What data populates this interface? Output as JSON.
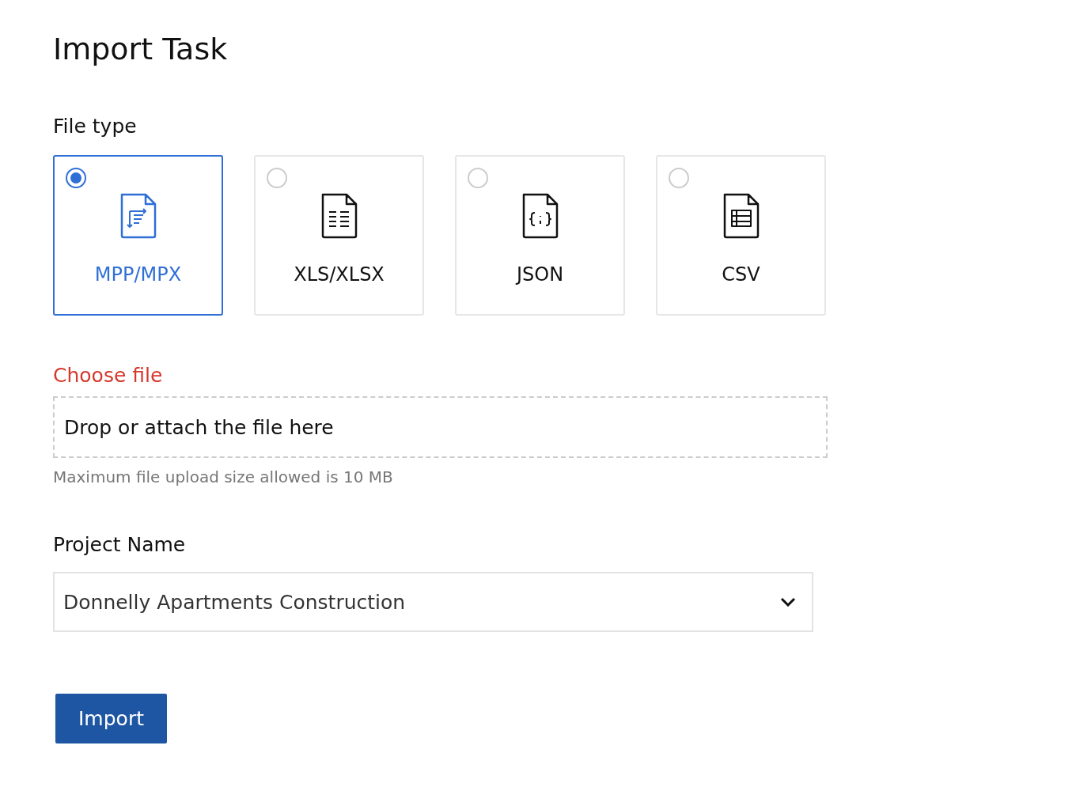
{
  "title": "Import Task",
  "file_type": {
    "label": "File type",
    "options": [
      {
        "label": "MPP/MPX",
        "kind": "gantt",
        "selected": true
      },
      {
        "label": "XLS/XLSX",
        "kind": "sheet",
        "selected": false
      },
      {
        "label": "JSON",
        "kind": "code",
        "selected": false
      },
      {
        "label": "CSV",
        "kind": "table",
        "selected": false
      }
    ]
  },
  "choose_file": {
    "label": "Choose file",
    "error": true,
    "placeholder": "Drop or attach the file here",
    "hint": "Maximum file upload size allowed is 10 MB"
  },
  "project": {
    "label": "Project Name",
    "value": "Donnelly Apartments Construction"
  },
  "buttons": [
    "Import"
  ]
}
